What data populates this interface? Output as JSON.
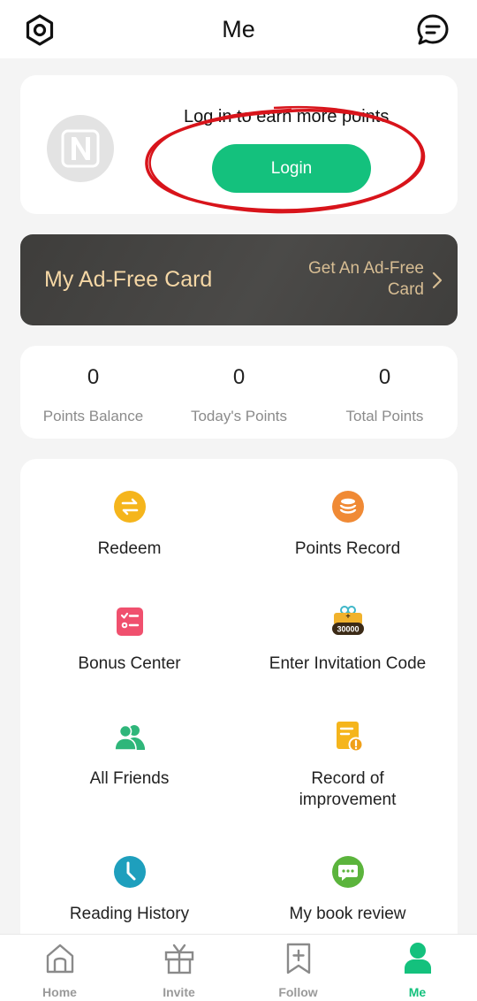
{
  "header": {
    "title": "Me",
    "left_icon": "hexagon-settings-icon",
    "right_icon": "message-icon"
  },
  "login_card": {
    "avatar_icon": "n-logo-avatar",
    "prompt": "Log in to earn more points",
    "login_label": "Login",
    "annotation": "red-circle-highlight"
  },
  "adfree_card": {
    "title": "My Ad-Free Card",
    "link_label": "Get An Ad-Free Card",
    "chevron_icon": "chevron-right-icon"
  },
  "points": [
    {
      "value": "0",
      "label": "Points Balance"
    },
    {
      "value": "0",
      "label": "Today's Points"
    },
    {
      "value": "0",
      "label": "Total Points"
    }
  ],
  "menu": [
    {
      "label": "Redeem",
      "icon": "exchange-icon",
      "color": "#f5b51c"
    },
    {
      "label": "Points Record",
      "icon": "coin-stack-icon",
      "color": "#f08a35"
    },
    {
      "label": "Bonus Center",
      "icon": "checklist-icon",
      "color": "#f0506e"
    },
    {
      "label": "Enter Invitation Code",
      "icon": "gift-30000-icon",
      "color": "#f1b22c",
      "badge": "30000"
    },
    {
      "label": "All Friends",
      "icon": "friends-icon",
      "color": "#2fb67a"
    },
    {
      "label": "Record of improvement",
      "icon": "document-warning-icon",
      "color": "#f5b51c"
    },
    {
      "label": "Reading History",
      "icon": "clock-icon",
      "color": "#1e9fbd"
    },
    {
      "label": "My book review",
      "icon": "comment-icon",
      "color": "#5bb43c"
    }
  ],
  "tabs": [
    {
      "label": "Home",
      "icon": "home-icon"
    },
    {
      "label": "Invite",
      "icon": "gift-icon"
    },
    {
      "label": "Follow",
      "icon": "bookmark-add-icon"
    },
    {
      "label": "Me",
      "icon": "person-icon",
      "active": true
    }
  ],
  "colors": {
    "accent": "#14c17d",
    "adfree_text": "#f5d7a5",
    "annotation_red": "#d8141b"
  }
}
